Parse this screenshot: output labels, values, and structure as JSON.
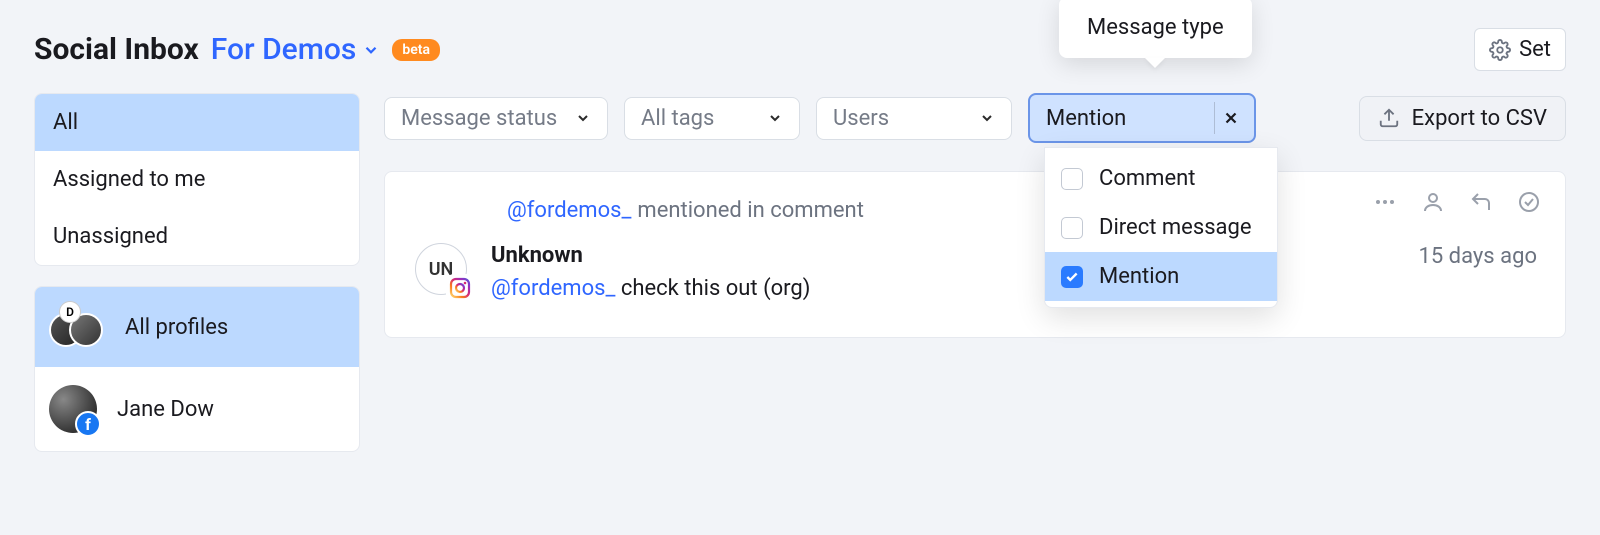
{
  "header": {
    "title": "Social Inbox",
    "project": "For Demos",
    "beta": "beta",
    "settings_label": "Set"
  },
  "sidebar": {
    "views": [
      {
        "label": "All",
        "active": true
      },
      {
        "label": "Assigned to me",
        "active": false
      },
      {
        "label": "Unassigned",
        "active": false
      }
    ],
    "profiles": [
      {
        "label": "All profiles",
        "active": true,
        "kind": "cluster",
        "cluster_badge": "D"
      },
      {
        "label": "Jane Dow",
        "active": false,
        "kind": "single",
        "network": "fb",
        "network_glyph": "f"
      }
    ]
  },
  "filters": {
    "message_status": "Message status",
    "tags": "All tags",
    "users": "Users",
    "message_type": {
      "label": "Mention",
      "tooltip": "Message type",
      "options": [
        {
          "label": "Comment",
          "checked": false
        },
        {
          "label": "Direct message",
          "checked": false
        },
        {
          "label": "Mention",
          "checked": true
        }
      ]
    },
    "export": "Export to CSV"
  },
  "message": {
    "context_handle": "@fordemos_",
    "context_suffix": " mentioned in comment",
    "sender": "Unknown",
    "avatar_initials": "UN",
    "text_handle": "@fordemos_",
    "text_rest": " check this out (org)",
    "time": "15 days ago"
  }
}
